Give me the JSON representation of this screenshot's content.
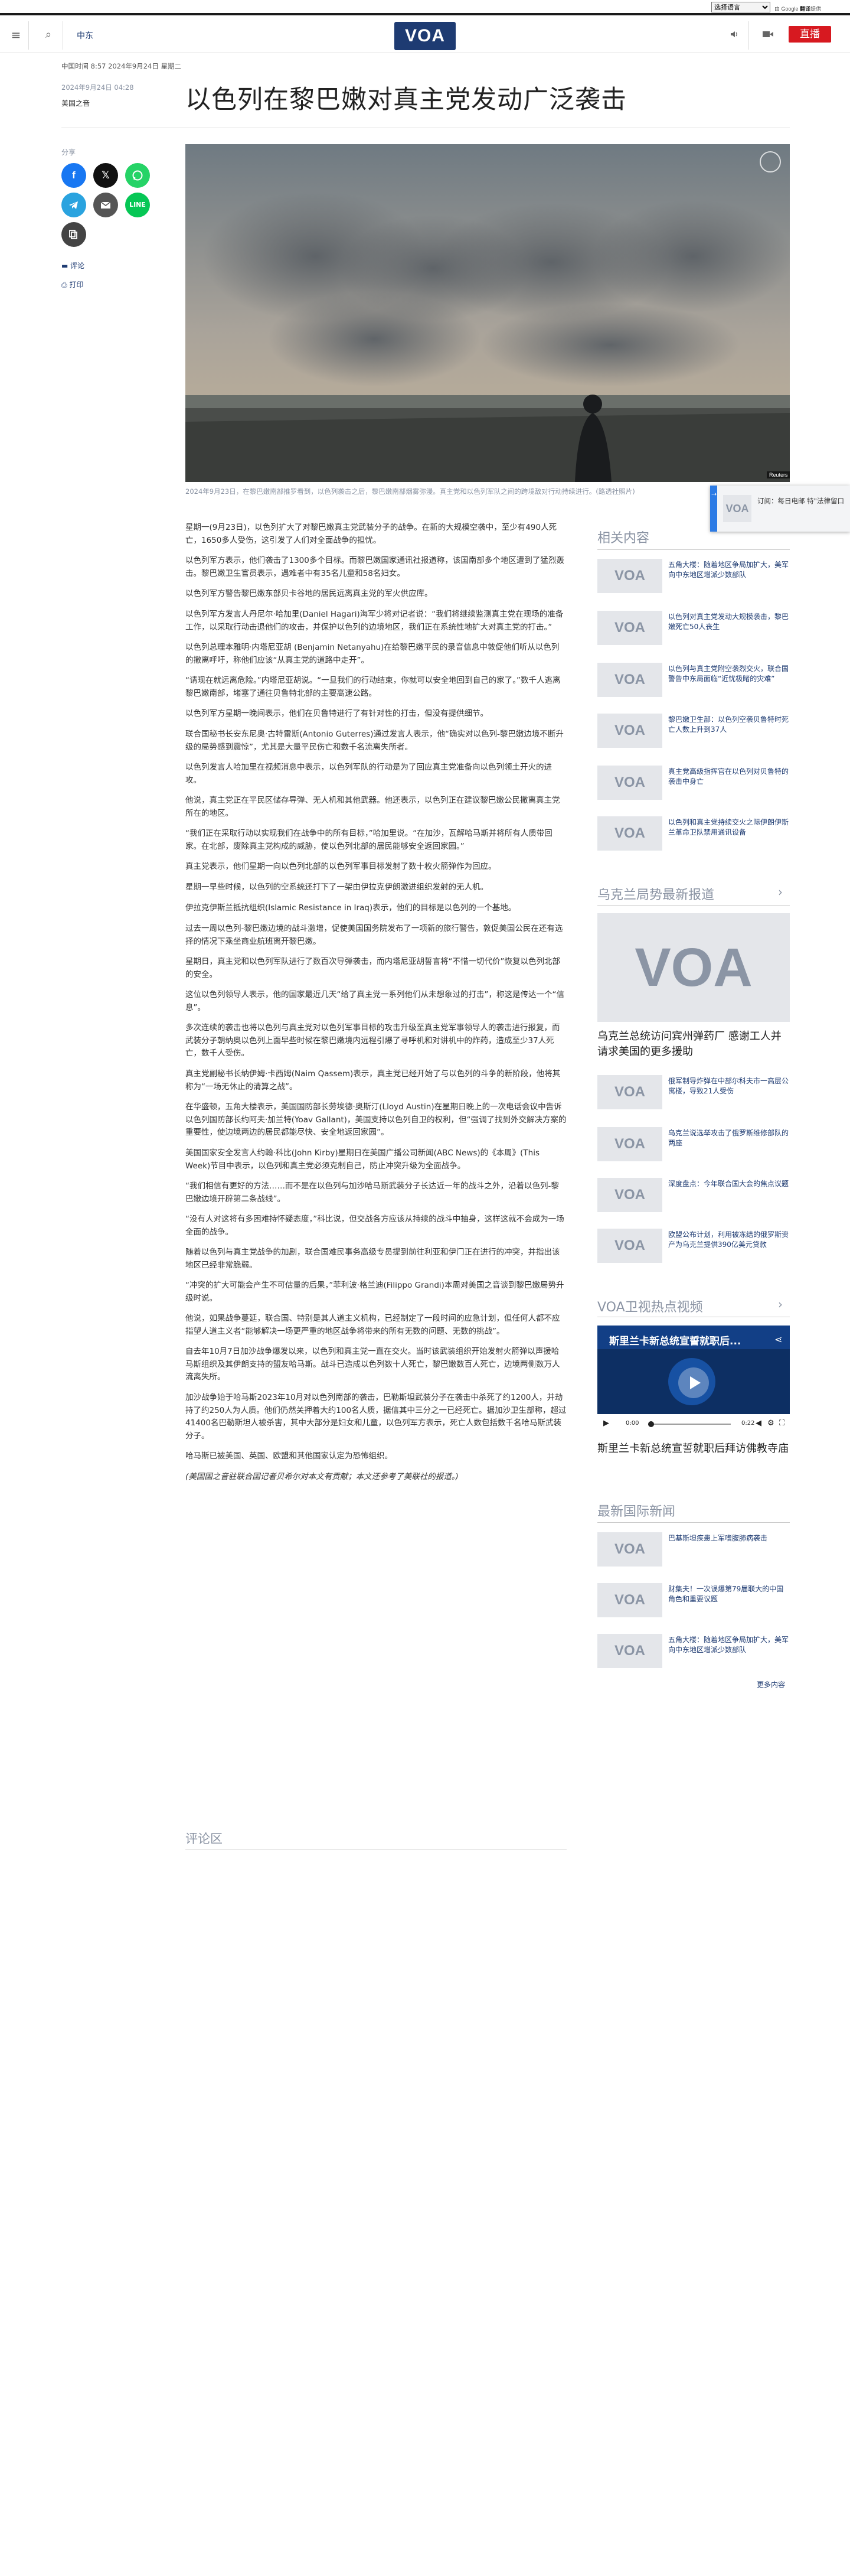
{
  "topbar": {
    "language_select": "选择语言",
    "powered": "由 Google",
    "powered_brand": "翻译",
    "powered_suffix": "提供"
  },
  "header": {
    "menu_icon": "≡",
    "search_icon": "⌕",
    "section": "中东",
    "logo": "VOA",
    "live": "直播"
  },
  "article": {
    "timestamp_main": "中国时间 8:57 2024年9月24日 星期二",
    "date_small": "2024年9月24日 04:28",
    "author": "美国之音",
    "title": "以色列在黎巴嫩对真主党发动广泛袭击",
    "share_label": "分享",
    "comment_label": "评论",
    "print_label": "打印",
    "photo_credit": "Reuters",
    "caption": "2024年9月23日，在黎巴嫩南部推罗看到，以色列袭击之后，黎巴嫩南部烟雾弥漫。真主党和以色列军队之间的跨境敌对行动持续进行。(路透社照片)",
    "paragraphs": [
      "星期一(9月23日)，以色列扩大了对黎巴嫩真主党武装分子的战争。在新的大规模空袭中，至少有490人死亡，1650多人受伤，这引发了人们对全面战争的担忧。",
      "以色列军方表示，他们袭击了1300多个目标。而黎巴嫩国家通讯社报道称，该国南部多个地区遭到了猛烈轰击。黎巴嫩卫生官员表示，遇难者中有35名儿童和58名妇女。",
      "以色列军方警告黎巴嫩东部贝卡谷地的居民远离真主党的军火供应库。",
      "以色列军方发言人丹尼尔·哈加里(Daniel Hagari)海军少将对记者说：“我们将继续监测真主党在现场的准备工作，以采取行动击退他们的攻击，并保护以色列的边境地区，我们正在系统性地扩大对真主党的打击。”",
      "以色列总理本雅明·内塔尼亚胡 (Benjamin Netanyahu)在给黎巴嫩平民的录音信息中敦促他们听从以色列的撤离呼吁，称他们应该“从真主党的道路中走开”。",
      "“请现在就远离危险。”内塔尼亚胡说。“一旦我们的行动结束，你就可以安全地回到自己的家了。”数千人逃离黎巴嫩南部，堵塞了通往贝鲁特北部的主要高速公路。",
      "以色列军方星期一晚间表示，他们在贝鲁特进行了有针对性的打击，但没有提供细节。",
      "联合国秘书长安东尼奥·古特雷斯(Antonio Guterres)通过发言人表示，他“确实对以色列-黎巴嫩边境不断升级的局势感到震惊”，尤其是大量平民伤亡和数千名流离失所者。",
      "以色列发言人哈加里在视频消息中表示，以色列军队的行动是为了回应真主党准备向以色列领土开火的进攻。",
      "他说，真主党正在平民区储存导弹、无人机和其他武器。他还表示，以色列正在建议黎巴嫩公民撤离真主党所在的地区。",
      "“我们正在采取行动以实现我们在战争中的所有目标，”哈加里说。“在加沙，瓦解哈马斯并将所有人质带回家。在北部，废除真主党构成的威胁，使以色列北部的居民能够安全返回家园。”",
      "真主党表示，他们星期一向以色列北部的以色列军事目标发射了数十枚火箭弹作为回应。",
      "星期一早些时候，以色列的空系统还打下了一架由伊拉克伊朗激进组织发射的无人机。",
      "伊拉克伊斯兰抵抗组织(Islamic Resistance in Iraq)表示，他们的目标是以色列的一个基地。",
      "过去一周以色列-黎巴嫩边境的战斗激增，促使美国国务院发布了一项新的旅行警告，敦促美国公民在还有选择的情况下乘坐商业航班离开黎巴嫩。",
      "星期日，真主党和以色列军队进行了数百次导弹袭击，而内塔尼亚胡誓言将“不惜一切代价”恢复以色列北部的安全。",
      "这位以色列领导人表示，他的国家最近几天“给了真主党一系列他们从未想象过的打击”，称这是传达一个“信息”。",
      "多次连续的袭击也将以色列与真主党对以色列军事目标的攻击升级至真主党军事领导人的袭击进行报复，而武装分子朝纳奥以色列上面早些时候在黎巴嫩境内远程引爆了寻呼机和对讲机中的炸药，造成至少37人死亡，数千人受伤。",
      "真主党副秘书长纳伊姆·卡西姆(Naim Qassem)表示，真主党已经开始了与以色列的斗争的新阶段，他将其称为“一场无休止的清算之战”。",
      "在华盛顿，五角大楼表示，美国国防部长劳埃德·奥斯汀(Lloyd Austin)在星期日晚上的一次电话会议中告诉以色列国防部长约阿夫·加兰特(Yoav Gallant)，美国支持以色列自卫的权利，但“强调了找到外交解决方案的重要性，使边境两边的居民都能尽快、安全地返回家园”。",
      "美国国家安全发言人约翰·科比(John Kirby)星期日在美国广播公司新闻(ABC News)的《本周》(This Week)节目中表示，以色列和真主党必须克制自己，防止冲突升级为全面战争。",
      "“我们相信有更好的方法……而不是在以色列与加沙哈马斯武装分子长达近一年的战斗之外，沿着以色列-黎巴嫩边境开辟第二条战线”。",
      "“没有人对这将有多困难持怀疑态度，”科比说，但交战各方应该从持续的战斗中抽身，这样这就不会成为一场全面的战争。",
      "随着以色列与真主党战争的加剧，联合国难民事务高级专员提到前往利亚和伊门正在进行的冲突，并指出该地区已经非常脆弱。",
      "“冲突的扩大可能会产生不可估量的后果，”菲利波·格兰迪(Filippo Grandi)本周对美国之音谈到黎巴嫩局势升级时说。",
      "他说，如果战争蔓延，联合国、特别是其人道主义机构，已经制定了一段时间的应急计划，但任何人都不应指望人道主义者“能够解决一场更严重的地区战争将带来的所有无数的问题、无数的挑战”。",
      "自去年10月7日加沙战争爆发以来，以色列和真主党一直在交火。当时该武装组织开始发射火箭弹以声援哈马斯组织及其伊朗支持的盟友哈马斯。战斗已造成以色列数十人死亡，黎巴嫩数百人死亡，边境两侧数万人流离失所。",
      "加沙战争始于哈马斯2023年10月对以色列南部的袭击，巴勒斯坦武装分子在袭击中杀死了约1200人，并劫持了约250人为人质。他们仍然关押着大约100名人质，据信其中三分之一已经死亡。据加沙卫生部称，超过41400名巴勒斯坦人被杀害，其中大部分是妇女和儿童，以色列军方表示，死亡人数包括数千名哈马斯武装分子。",
      "哈马斯已被美国、英国、欧盟和其他国家认定为恐怖组织。",
      "(美国国之音驻联合国记者贝希尔对本文有贡献；本文还参考了美联社的报道。)"
    ],
    "comments_heading": "评论区"
  },
  "popup": {
    "text": "订阅：每日电邮 特\"法律留口"
  },
  "sidebar": {
    "related_heading": "相关内容",
    "related": [
      "五角大楼：随着地区争局加扩大，美军向中东地区增派少数部队",
      "以色列对真主党发动大规模袭击，黎巴嫩死亡50人丧生",
      "以色列与真主党附空袭烈交火，联合国警告中东局面临“近忧极睹的灾难”",
      "黎巴嫩卫生部：以色列空袭贝鲁特时死亡人数上升到37人",
      "真主党高级指挥官在以色列对贝鲁特的袭击中身亡",
      "以色列和真主党持续交火之际伊朗伊斯兰革命卫队禁用通讯设备"
    ],
    "ukraine_heading": "乌克兰局势最新报道",
    "ukraine_feature": "乌克兰总统访问宾州弹药厂 感谢工人并请求美国的更多援助",
    "ukraine": [
      "俄军制导炸弹在中部尔科夫市一高层公寓楼，导致21人受伤",
      "乌克兰说选举攻击了俄罗斯维修部队的两座",
      "深度盘点：今年联合国大会的焦点议题",
      "欧盟公布计划，利用被冻结的俄罗斯资产为乌克兰提供390亿美元贷款"
    ],
    "satellite_heading": "VOA卫视热点视频",
    "video": {
      "title": "斯里兰卡新总统宣誓就职后...",
      "time_current": "0:00",
      "time_total": "0:22",
      "caption": "斯里兰卡新总统宣誓就职后拜访佛教寺庙"
    },
    "intl_heading": "最新国际新闻",
    "intl": [
      "巴基斯坦疾患上军嗜腹肺病袭击",
      "财集夫！一次误爆第79届联大的中国角色和重要议题",
      "五角大楼：随着地区争局加扩大，美军向中东地区增派少数部队"
    ],
    "more": "更多内容"
  },
  "colors": {
    "brand": "#1e3b72",
    "live_red": "#d71920",
    "link": "#1e3b72",
    "facebook": "#1877f2",
    "x": "#111111",
    "whatsapp": "#25d366",
    "telegram": "#2aa3df",
    "email": "#555555",
    "line": "#06c755",
    "copy": "#444444"
  }
}
